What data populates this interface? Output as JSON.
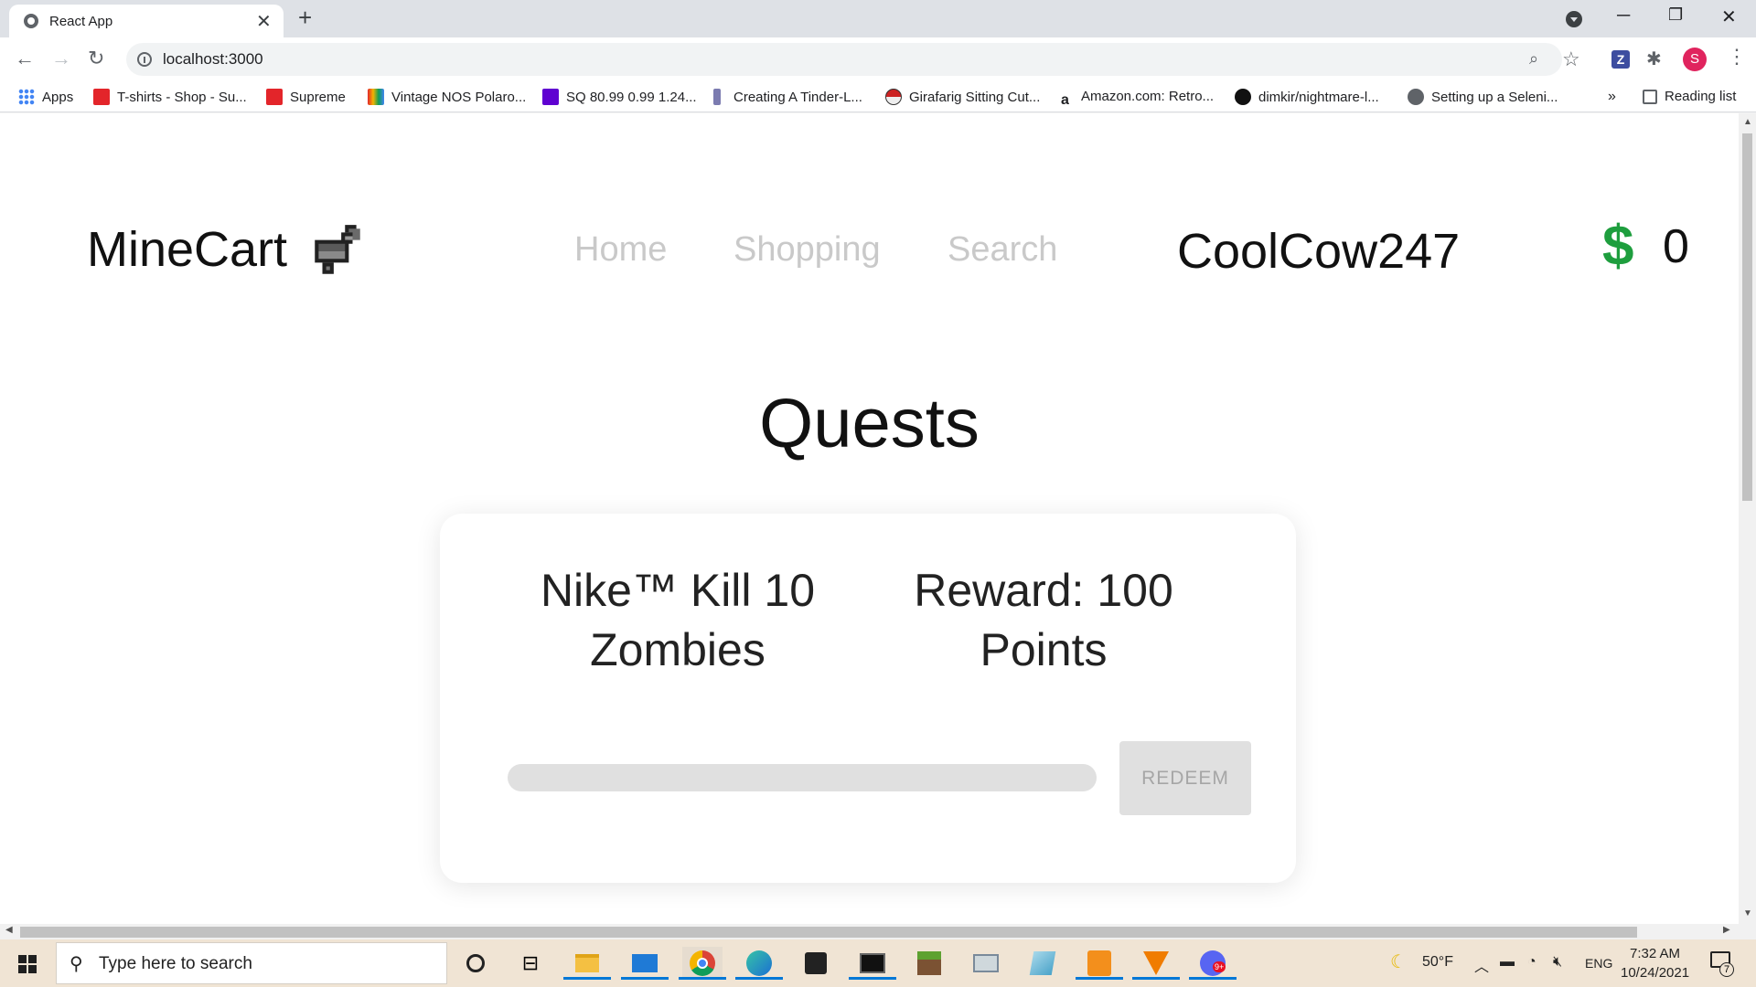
{
  "browser": {
    "tab_title": "React App",
    "url": "localhost:3000",
    "profile_initial": "S",
    "ext_z_label": "Z",
    "bookmarks": [
      {
        "label": "Apps",
        "color": "#4285f4",
        "icon": "apps-grid-icon"
      },
      {
        "label": "T-shirts - Shop - Su...",
        "color": "#e3252a",
        "icon": "supreme-icon"
      },
      {
        "label": "Supreme",
        "color": "#e3252a",
        "icon": "supreme-icon"
      },
      {
        "label": "Vintage NOS Polaro...",
        "color": "#7a4fbf",
        "icon": "shopping-bag-icon"
      },
      {
        "label": "SQ 80.99 0.99 1.24...",
        "color": "#5f01d1",
        "icon": "yahoo-icon"
      },
      {
        "label": "Creating A Tinder-L...",
        "color": "#4a4a8a",
        "icon": "figure-icon"
      },
      {
        "label": "Girafarig Sitting Cut...",
        "color": "#cc2222",
        "icon": "pokeball-icon"
      },
      {
        "label": "Amazon.com: Retro...",
        "color": "#111111",
        "icon": "amazon-icon"
      },
      {
        "label": "dimkir/nightmare-l...",
        "color": "#111111",
        "icon": "github-icon"
      },
      {
        "label": "Setting up a Seleni...",
        "color": "#5f6368",
        "icon": "globe-icon"
      }
    ],
    "bookmarks_overflow": "»",
    "reading_list": "Reading list"
  },
  "app": {
    "logo": "MineCart",
    "nav": [
      "Home",
      "Shopping",
      "Search"
    ],
    "username": "CoolCow247",
    "currency_symbol": "$",
    "currency_color": "#1e9e3e",
    "balance": "0",
    "page_title": "Quests",
    "quests": [
      {
        "name": "Nike™ Kill 10 Zombies",
        "reward": "Reward: 100 Points",
        "progress": 0,
        "redeem_label": "REDEEM"
      }
    ]
  },
  "taskbar": {
    "search_placeholder": "Type here to search",
    "apps": [
      "cortana-icon",
      "task-view-icon",
      "file-explorer-icon",
      "mail-icon",
      "chrome-icon",
      "edge-icon",
      "store-icon",
      "terminal-icon",
      "minecraft-icon",
      "photos-icon",
      "notepad-icon",
      "sublime-icon",
      "vlc-icon",
      "discord-icon"
    ],
    "weather": "50°F",
    "language": "ENG",
    "time": "7:32 AM",
    "date": "10/24/2021",
    "notification_count": "7",
    "discord_badge": "9+"
  }
}
